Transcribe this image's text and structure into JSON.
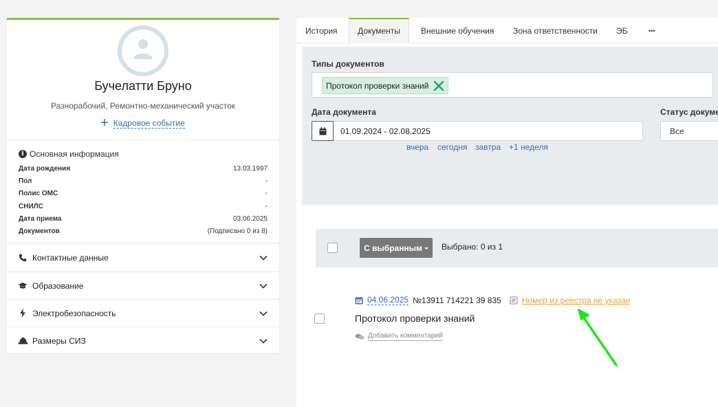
{
  "profile": {
    "name": "Бучелатти Бруно",
    "role": "Разнорабочий, Ремонтно-механический участок",
    "hr_event_label": "Кадровое событие",
    "hr_event_plus": "+"
  },
  "basic_info": {
    "title": "Основная информация",
    "info_icon_glyph": "i",
    "rows": [
      {
        "label": "Дата рождения",
        "value": "13.03.1997"
      },
      {
        "label": "Пол",
        "value": "-"
      },
      {
        "label": "Полис ОМС",
        "value": "-"
      },
      {
        "label": "СНИЛС",
        "value": "-"
      },
      {
        "label": "Дата приема",
        "value": "03.06.2025"
      },
      {
        "label": "Документов",
        "value": "(Подписано 0 из 8)"
      }
    ]
  },
  "sections": [
    {
      "label": "Контактные данные",
      "icon": "phone-icon"
    },
    {
      "label": "Образование",
      "icon": "graduation-cap-icon"
    },
    {
      "label": "Электробезопасность",
      "icon": "lightning-icon"
    },
    {
      "label": "Размеры СИЗ",
      "icon": "hard-hat-icon"
    }
  ],
  "tabs": [
    {
      "label": "История"
    },
    {
      "label": "Документы",
      "active": true
    },
    {
      "label": "Внешние обучения"
    },
    {
      "label": "Зона ответственности"
    },
    {
      "label": "ЭБ"
    },
    {
      "label": "•••"
    }
  ],
  "filters": {
    "doc_types_label": "Типы документов",
    "doc_type_tag": "Протокол проверки знаний",
    "doc_date_label": "Дата документа",
    "doc_date_value": "01.09.2024 - 02.08.2025",
    "quick_ranges": [
      "вчера",
      "сегодня",
      "завтра",
      "+1 неделя"
    ],
    "status_label": "Статус докуме",
    "status_value": "Все"
  },
  "bulk": {
    "button_label": "С выбранным",
    "selected_text": "Выбрано: 0 из 1"
  },
  "document": {
    "date": "04.06.2025",
    "number": "№13911 714221 39 835",
    "registry_warning": "Номер из реестра не указан",
    "title": "Протокол проверки знаний",
    "add_comment_label": "Добавить комментарий"
  },
  "colors": {
    "accent_green": "#7dc23d",
    "link_blue": "#2f6fb5",
    "warning_orange": "#e6a23c",
    "tag_remove_green": "#21a366",
    "annotation_arrow": "#22e41f"
  }
}
